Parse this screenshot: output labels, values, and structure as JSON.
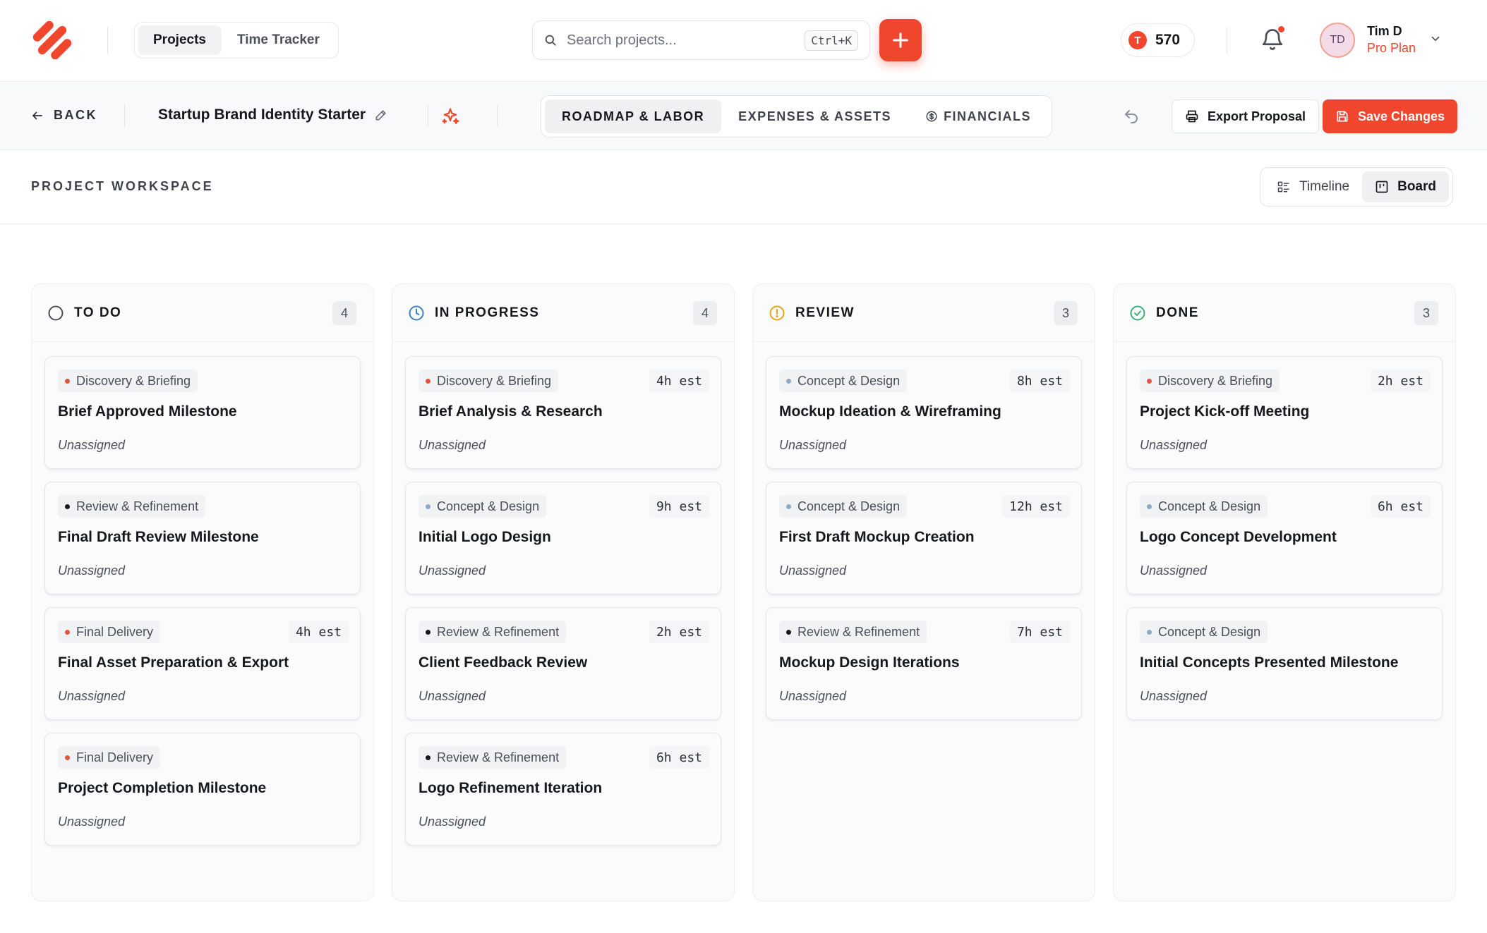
{
  "header": {
    "nav": [
      {
        "label": "Projects",
        "active": true
      },
      {
        "label": "Time Tracker",
        "active": false
      }
    ],
    "search": {
      "placeholder": "Search projects...",
      "shortcut": "Ctrl+K"
    },
    "credits": {
      "coin_letter": "T",
      "count": "570"
    },
    "user": {
      "initials": "TD",
      "name": "Tim D",
      "plan": "Pro Plan"
    },
    "colors": {
      "accent": "#f0462e"
    }
  },
  "project_bar": {
    "back_label": "BACK",
    "title": "Startup Brand Identity Starter",
    "tabs": [
      {
        "label": "ROADMAP & LABOR",
        "active": true
      },
      {
        "label": "EXPENSES & ASSETS",
        "active": false
      },
      {
        "label": "FINANCIALS",
        "active": false,
        "icon": "dollar-circle-icon"
      }
    ],
    "export_label": "Export Proposal",
    "save_label": "Save Changes"
  },
  "workspace": {
    "title": "PROJECT WORKSPACE",
    "views": [
      {
        "label": "Timeline",
        "active": false
      },
      {
        "label": "Board",
        "active": true
      }
    ]
  },
  "board": {
    "columns": [
      {
        "title": "TO DO",
        "count": "4",
        "icon": "circle-icon",
        "icon_color": "#4a4f5a",
        "cards": [
          {
            "tag": "Discovery & Briefing",
            "tag_color": "#e5533d",
            "estimate": "",
            "title": "Brief Approved Milestone",
            "assignee": "Unassigned"
          },
          {
            "tag": "Review & Refinement",
            "tag_color": "#16181d",
            "estimate": "",
            "title": "Final Draft Review Milestone",
            "assignee": "Unassigned"
          },
          {
            "tag": "Final Delivery",
            "tag_color": "#e5533d",
            "estimate": "4h est",
            "title": "Final Asset Preparation & Export",
            "assignee": "Unassigned"
          },
          {
            "tag": "Final Delivery",
            "tag_color": "#e5533d",
            "estimate": "",
            "title": "Project Completion Milestone",
            "assignee": "Unassigned"
          }
        ]
      },
      {
        "title": "IN PROGRESS",
        "count": "4",
        "icon": "clock-icon",
        "icon_color": "#3b82c4",
        "cards": [
          {
            "tag": "Discovery & Briefing",
            "tag_color": "#e5533d",
            "estimate": "4h est",
            "title": "Brief Analysis & Research",
            "assignee": "Unassigned"
          },
          {
            "tag": "Concept & Design",
            "tag_color": "#8fa9c4",
            "estimate": "9h est",
            "title": "Initial Logo Design",
            "assignee": "Unassigned"
          },
          {
            "tag": "Review & Refinement",
            "tag_color": "#16181d",
            "estimate": "2h est",
            "title": "Client Feedback Review",
            "assignee": "Unassigned"
          },
          {
            "tag": "Review & Refinement",
            "tag_color": "#16181d",
            "estimate": "6h est",
            "title": "Logo Refinement Iteration",
            "assignee": "Unassigned"
          }
        ]
      },
      {
        "title": "REVIEW",
        "count": "3",
        "icon": "alert-circle-icon",
        "icon_color": "#e8a317",
        "cards": [
          {
            "tag": "Concept & Design",
            "tag_color": "#8fa9c4",
            "estimate": "8h est",
            "title": "Mockup Ideation & Wireframing",
            "assignee": "Unassigned"
          },
          {
            "tag": "Concept & Design",
            "tag_color": "#8fa9c4",
            "estimate": "12h est",
            "title": "First Draft Mockup Creation",
            "assignee": "Unassigned"
          },
          {
            "tag": "Review & Refinement",
            "tag_color": "#16181d",
            "estimate": "7h est",
            "title": "Mockup Design Iterations",
            "assignee": "Unassigned"
          }
        ]
      },
      {
        "title": "DONE",
        "count": "3",
        "icon": "check-circle-icon",
        "icon_color": "#3fae7a",
        "cards": [
          {
            "tag": "Discovery & Briefing",
            "tag_color": "#e5533d",
            "estimate": "2h est",
            "title": "Project Kick-off Meeting",
            "assignee": "Unassigned"
          },
          {
            "tag": "Concept & Design",
            "tag_color": "#8fa9c4",
            "estimate": "6h est",
            "title": "Logo Concept Development",
            "assignee": "Unassigned"
          },
          {
            "tag": "Concept & Design",
            "tag_color": "#8fa9c4",
            "estimate": "",
            "title": "Initial Concepts Presented Milestone",
            "assignee": "Unassigned"
          }
        ]
      }
    ]
  }
}
